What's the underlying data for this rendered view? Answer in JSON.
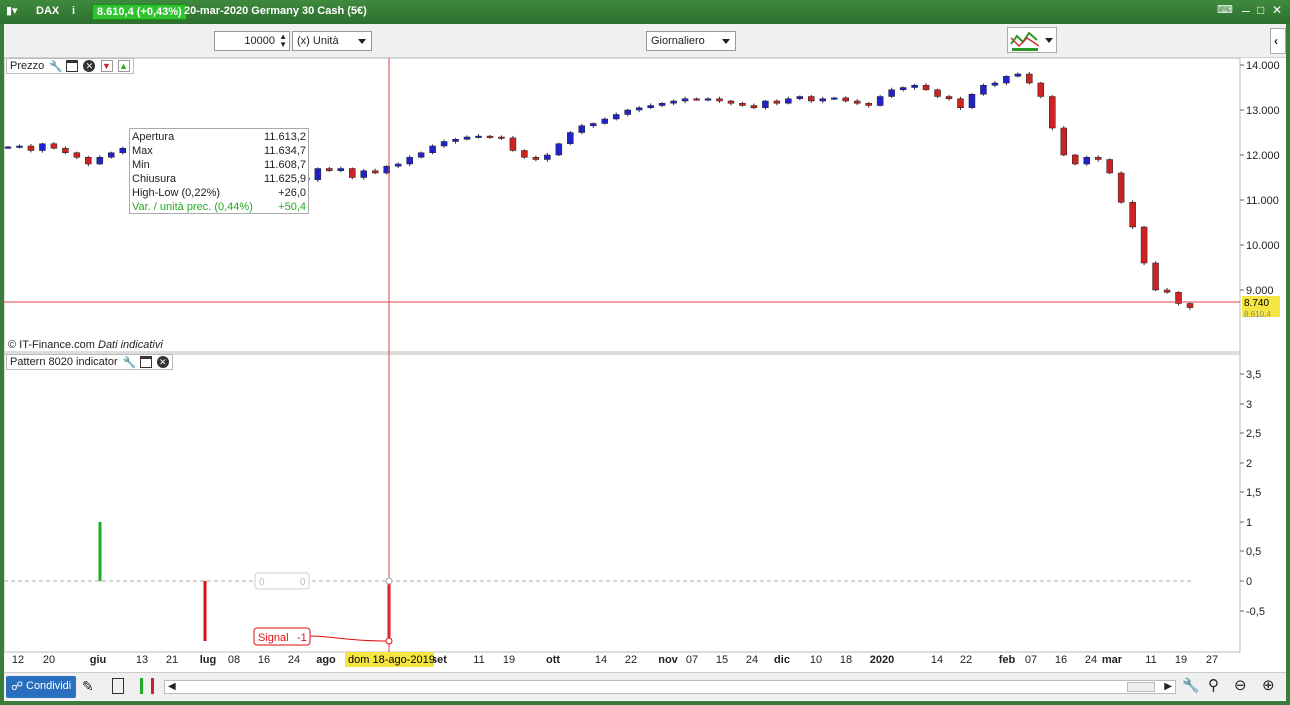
{
  "titlebar": {
    "symbol": "DAX",
    "price_badge": "8.610,4 (+0,43%)",
    "title": "20-mar-2020 Germany 30 Cash (5€)"
  },
  "toolbar": {
    "quantity_value": "10000",
    "unit_select": "(x) Unità",
    "period_select": "Giornaliero"
  },
  "price_pane": {
    "label": "Prezzo",
    "copyright": "© IT-Finance.com",
    "disclaimer": "Dati indicativi",
    "price_tag_top": "8.740",
    "price_tag_bottom": "8.610,4",
    "y_ticks": [
      "14.000",
      "13.000",
      "12.000",
      "11.000",
      "10.000",
      "9.000"
    ]
  },
  "ohlc_tooltip": {
    "rows": [
      {
        "label": "Apertura",
        "value": "11.613,2"
      },
      {
        "label": "Max",
        "value": "11.634,7"
      },
      {
        "label": "Min",
        "value": "11.608,7"
      },
      {
        "label": "Chiusura",
        "value": "11.625,9"
      },
      {
        "label": "High-Low (0,22%)",
        "value": "+26,0"
      },
      {
        "label": "Var. / unità prec. (0,44%)",
        "value": "+50,4"
      }
    ]
  },
  "indicator_pane": {
    "label": "Pattern 8020 indicator",
    "y_ticks": [
      "3,5",
      "3",
      "2,5",
      "2",
      "1,5",
      "1",
      "0,5",
      "0",
      "-0,5"
    ],
    "zero_box_left": "0",
    "zero_box_right": "0",
    "signal_label": "Signal",
    "signal_value": "-1"
  },
  "x_axis": {
    "labels": [
      "12",
      "20",
      "giu",
      "13",
      "21",
      "lug",
      "08",
      "16",
      "24",
      "ago",
      "set",
      "11",
      "19",
      "ott",
      "14",
      "22",
      "nov",
      "07",
      "15",
      "24",
      "dic",
      "10",
      "18",
      "2020",
      "14",
      "22",
      "feb",
      "07",
      "16",
      "24",
      "mar",
      "11",
      "19",
      "27"
    ],
    "cursor_date": "dom 18-ago-2019"
  },
  "bottombar": {
    "share_label": "Condividi"
  },
  "chart_data": {
    "type": "candlestick",
    "ylim": [
      8000,
      14200
    ],
    "closes": [
      12180,
      12200,
      12100,
      12250,
      12150,
      12050,
      11950,
      11800,
      11950,
      12050,
      12150,
      12250,
      12300,
      12330,
      12340,
      12330,
      12350,
      12330,
      12340,
      12310,
      12250,
      12100,
      11900,
      11750,
      11600,
      11500,
      11450,
      11700,
      11650,
      11700,
      11500,
      11650,
      11600,
      11750,
      11800,
      11950,
      12050,
      12200,
      12300,
      12350,
      12400,
      12420,
      12400,
      12380,
      12100,
      11950,
      11900,
      12000,
      12250,
      12500,
      12650,
      12700,
      12800,
      12900,
      13000,
      13050,
      13100,
      13150,
      13200,
      13250,
      13230,
      13250,
      13200,
      13150,
      13100,
      13050,
      13200,
      13150,
      13250,
      13300,
      13200,
      13250,
      13270,
      13200,
      13150,
      13100,
      13300,
      13450,
      13500,
      13550,
      13450,
      13300,
      13250,
      13050,
      13350,
      13550,
      13600,
      13750,
      13800,
      13600,
      13300,
      12600,
      12000,
      11800,
      11950,
      11900,
      11600,
      10950,
      10400,
      9600,
      9000,
      8950,
      8700,
      8610
    ]
  },
  "colors": {
    "up": "#2222cc",
    "down": "#cc2222",
    "signal_pos": "#22aa22",
    "signal_neg": "#dd1111",
    "cursor": "#e04040",
    "price_tag": "#f5e642"
  }
}
